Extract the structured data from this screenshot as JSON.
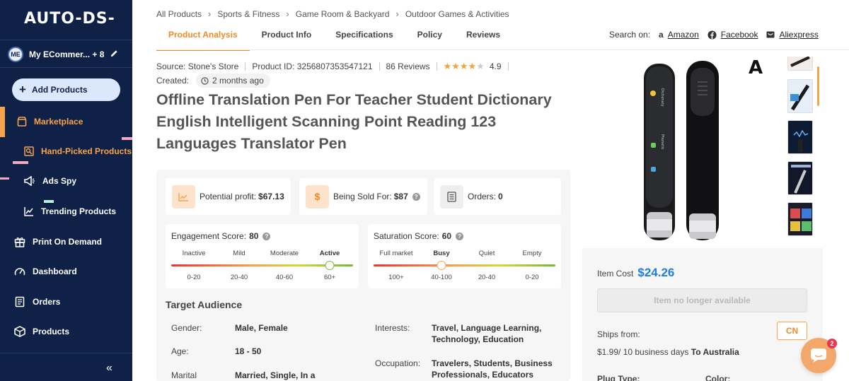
{
  "sidebar": {
    "logo": "AUTO-DS-",
    "store": {
      "initials": "ME",
      "name": "My ECommer... + 8"
    },
    "add_products": "Add Products",
    "items": [
      {
        "label": "Marketplace"
      },
      {
        "label": "Hand-Picked Products"
      },
      {
        "label": "Ads Spy"
      },
      {
        "label": "Trending Products"
      },
      {
        "label": "Print On Demand"
      },
      {
        "label": "Dashboard"
      },
      {
        "label": "Orders"
      },
      {
        "label": "Products"
      }
    ],
    "collapse": "«"
  },
  "breadcrumb": [
    "All Products",
    "Sports & Fitness",
    "Game Room & Backyard",
    "Outdoor Games & Activities"
  ],
  "tabs": [
    "Product Analysis",
    "Product Info",
    "Specifications",
    "Policy",
    "Reviews"
  ],
  "search_on": {
    "label": "Search on:",
    "links": [
      "Amazon",
      "Facebook",
      "Aliexpress"
    ]
  },
  "meta": {
    "source": "Source: Stone's Store",
    "product_id": "Product ID: 3256807353547121",
    "reviews": "86 Reviews",
    "rating": "4.9",
    "rating_value": 4.5,
    "created_label": "Created:",
    "created_ago": "2 months ago"
  },
  "title": "Offline Translation Pen For Teacher Student Dictionary English Intelligent Scanning Point Reading 123 Languages Translator Pen",
  "stats": {
    "profit_label": "Potential profit:",
    "profit_value": "$67.13",
    "sold_label": "Being Sold For:",
    "sold_value": "$87",
    "orders_label": "Orders:",
    "orders_value": "0"
  },
  "engagement": {
    "label": "Engagement Score:",
    "value": "80",
    "levels": [
      "Inactive",
      "Mild",
      "Moderate",
      "Active"
    ],
    "ranges": [
      "0-20",
      "20-40",
      "40-60",
      "60+"
    ],
    "active_index": 3
  },
  "saturation": {
    "label": "Saturation Score:",
    "value": "60",
    "levels": [
      "Full market",
      "Busy",
      "Quiet",
      "Empty"
    ],
    "ranges": [
      "100+",
      "40-100",
      "20-40",
      "0-20"
    ],
    "active_index": 1
  },
  "audience": {
    "title": "Target Audience",
    "gender_label": "Gender:",
    "gender": "Male, Female",
    "age_label": "Age:",
    "age": "18 - 50",
    "marital_label": "Marital",
    "marital": "Married, Single, In a",
    "interests_label": "Interests:",
    "interests": "Travel, Language Learning, Technology, Education",
    "occupation_label": "Occupation:",
    "occupation": "Travelers, Students, Business Professionals, Educators"
  },
  "pricing": {
    "item_cost_label": "Item Cost",
    "item_cost": "$24.26",
    "unavailable": "Item no longer available",
    "ships_from_label": "Ships from:",
    "ship_from_country": "CN",
    "shipping_price": "$1.99",
    "shipping_days": "/ 10 business days",
    "shipping_to": "To Australia",
    "plug_label": "Plug Type:",
    "color_label": "Color:"
  },
  "image_watermark": "A",
  "chat_badge": "2",
  "colors": {
    "sidebar_bg": "#0f2147",
    "accent": "#f08a24",
    "link_blue": "#1e7fe0"
  }
}
